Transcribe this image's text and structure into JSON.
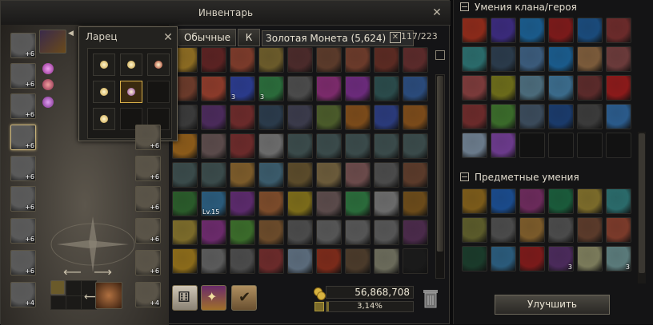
{
  "inventory": {
    "title": "Инвентарь",
    "tabs": [
      "Обычные",
      "К"
    ],
    "tooltip": "Золотая Монета (5,624)",
    "slots_count": "117/223",
    "adena": "56,868,708",
    "weight": "3,14%",
    "weight_fraction": 0.0314,
    "equipment_left": [
      {
        "icon": "helmet-icon",
        "count": "6"
      },
      {
        "icon": "armor-icon",
        "count": "6"
      },
      {
        "icon": "leg-armor-icon",
        "count": "6"
      },
      {
        "icon": "sword-icon",
        "count": "6",
        "selected": true
      },
      {
        "icon": "dagger-icon",
        "count": "6"
      },
      {
        "icon": "cloak-icon",
        "count": "6"
      },
      {
        "icon": "shirt-icon",
        "count": "6"
      },
      {
        "icon": "ring-icon",
        "count": "6"
      },
      {
        "icon": "spear-icon",
        "count": "4"
      }
    ],
    "equipment_right": [
      {
        "icon": "earring-icon",
        "count": "6"
      },
      {
        "icon": "necklace-icon",
        "count": "6"
      },
      {
        "icon": "ring-icon",
        "count": "6"
      },
      {
        "icon": "glove-icon",
        "count": "6"
      },
      {
        "icon": "boots-icon",
        "count": "6"
      },
      {
        "icon": "lance-icon",
        "count": "4"
      }
    ],
    "grid_colors": [
      [
        "#8a6a22",
        "#5a2222",
        "#7a3a2a",
        "#6a5a2a",
        "#4a2a2a",
        "#5a3a2a",
        "#6a3a2a",
        "#5a2a22",
        "#5a2a2a"
      ],
      [
        "#6a3a2a",
        "#8a3a2a",
        "#2a3a8a",
        "#2a6a3a",
        "#4a4a4a",
        "#7a2a6a",
        "#6a2a7a",
        "#2a4a4a",
        "#2a4a7a"
      ],
      [
        "#3a3a3a",
        "#4a2a5a",
        "#6a2a2a",
        "#2a3a4a",
        "#3a3a4a",
        "#4a5a2a",
        "#7a4a1a",
        "#2a3a7a",
        "#7a4a1a"
      ],
      [
        "#8a5a1a",
        "#5a4a4a",
        "#6a2a2a",
        "#6a6a6a",
        "#3a4a4a",
        "#3a4a4a",
        "#3a4a4a",
        "#3a4a4a",
        "#3a4a4a"
      ],
      [
        "#3a4a4a",
        "#3a4a4a",
        "#7a5a2a",
        "#3a5a6a",
        "#5a4a2a",
        "#6a5a3a",
        "#6a4a4a",
        "#4a4a4a",
        "#5a3a2a"
      ],
      [
        "#2a5a2a",
        "#2a5a7a",
        "#5a2a6a",
        "#7a4a2a",
        "#7a6a1a",
        "#5a4a4a",
        "#2a6a3a",
        "#6a6a6a",
        "#6a4a1a"
      ],
      [
        "#7a6a2a",
        "#6a2a6a",
        "#3a6a2a",
        "#6a4a2a",
        "#4a4a4a",
        "#555555",
        "#555555",
        "#555555",
        "#4a2a4a"
      ],
      [
        "#8a6a1a",
        "#5a5a5a",
        "#4a4a4a",
        "#6a2a2a",
        "#5a6a7a",
        "#7a2a1a",
        "#4a3a2a",
        "#6a6a5a",
        "#1a1a1a"
      ]
    ],
    "grid_counts": [
      [
        "",
        "",
        "",
        "",
        "",
        "",
        "",
        "",
        ""
      ],
      [
        "",
        "",
        "3",
        "3",
        "",
        "",
        "",
        "",
        ""
      ],
      [
        "",
        "",
        "",
        "",
        "",
        "",
        "",
        "",
        ""
      ],
      [
        "",
        "",
        "",
        "",
        "",
        "",
        "",
        "",
        ""
      ],
      [
        "",
        "",
        "",
        "",
        "",
        "",
        "",
        "",
        ""
      ],
      [
        "",
        "15",
        "",
        "",
        "",
        "",
        "",
        "",
        ""
      ],
      [
        "",
        "",
        "",
        "",
        "",
        "",
        "",
        "",
        ""
      ],
      [
        "",
        "",
        "",
        "",
        "",
        "",
        "",
        "",
        ""
      ]
    ],
    "bottom_buttons": [
      "dice-icon",
      "sort-icon",
      "confirm-icon"
    ]
  },
  "chest": {
    "title": "Ларец",
    "slots": [
      "gold-gem-icon",
      "gold-gem-icon",
      "red-gem-icon",
      "gold-gem-icon",
      "purple-jewel-icon",
      "",
      "gold-gem-icon",
      "",
      ""
    ]
  },
  "skills": {
    "clan_title": "Умения клана/героя",
    "items_title": "Предметные умения",
    "upgrade_label": "Улучшить",
    "clan_colors": [
      [
        "#8a2a1a",
        "#3a2a7a",
        "#1a5a8a",
        "#7a1a1a",
        "#1a4a7a",
        "#6a2a2a"
      ],
      [
        "#2a6a6a",
        "#2a3a4a",
        "#3a5a7a",
        "#1a5a8a",
        "#7a5a3a",
        "#6a3a3a"
      ],
      [
        "#7a3a3a",
        "#6a6a1a",
        "#4a6a7a",
        "#3a6a8a",
        "#5a2a2a",
        "#8a1a1a"
      ],
      [
        "#6a2a2a",
        "#3a6a2a",
        "#3a4a5a",
        "#1a3a6a",
        "#3a3a3a",
        "#2a5a8a"
      ],
      [
        "#6a7a8a",
        "#6a3a8a",
        "",
        "",
        "",
        ""
      ]
    ],
    "item_colors": [
      [
        "#7a5a1a",
        "#1a4a8a",
        "#6a2a5a",
        "#1a5a3a",
        "#7a6a2a",
        "#2a6a6a"
      ],
      [
        "#5a5a2a",
        "#4a4a4a",
        "#7a5a2a",
        "#4a4a4a",
        "#5a3a2a",
        "#7a3a2a"
      ],
      [
        "#1a3a2a",
        "#2a5a7a",
        "#7a1a1a",
        "#4a2a5a",
        "#7a7a5a",
        "#5a7a7a"
      ]
    ],
    "item_counts": [
      [
        "",
        "",
        "",
        "",
        "",
        ""
      ],
      [
        "",
        "",
        "",
        "",
        "",
        ""
      ],
      [
        "",
        "",
        "",
        "3",
        "",
        "3"
      ]
    ]
  }
}
